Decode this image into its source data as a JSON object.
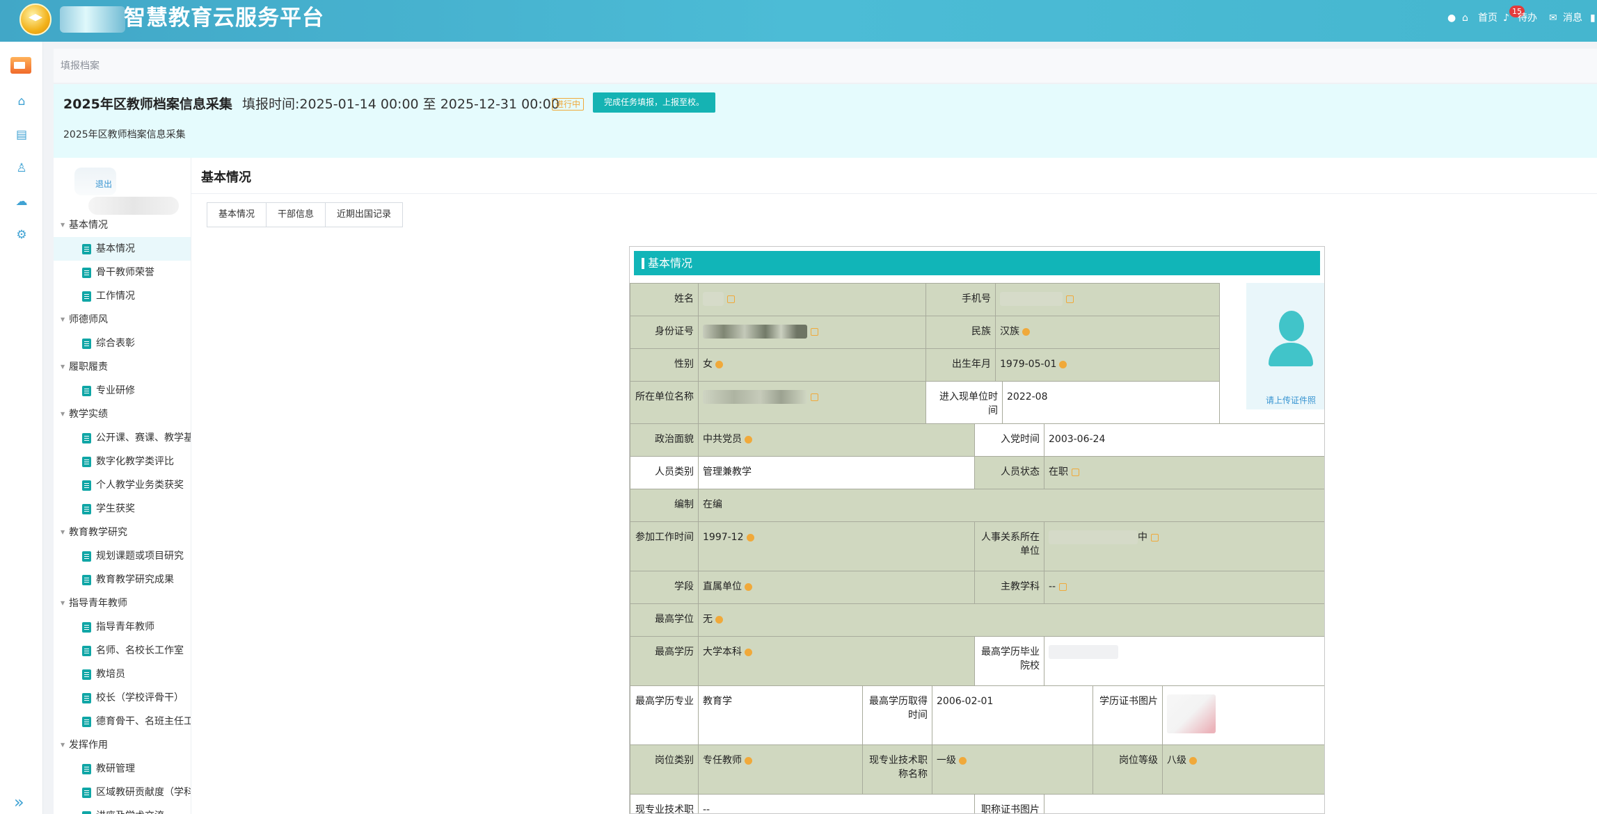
{
  "header": {
    "app_title": "智慧教育云服务平台",
    "nav": {
      "home": "首页",
      "todo": "待办",
      "todo_count": "15",
      "messages": "消息"
    }
  },
  "breadcrumb": "填报档案",
  "task": {
    "title": "2025年区教师档案信息采集",
    "time_range": "填报时间:2025-01-14 00:00 至 2025-12-31 00:00",
    "status": "进行中",
    "submit_label": "完成任务填报，上报至校。",
    "description": "2025年区教师档案信息采集"
  },
  "user_panel": {
    "logout_label": "退出"
  },
  "tree": {
    "groups": [
      {
        "label": "基本情况",
        "items": [
          "基本情况",
          "骨干教师荣誉",
          "工作情况"
        ]
      },
      {
        "label": "师德师风",
        "items": [
          "综合表彰"
        ]
      },
      {
        "label": "履职履责",
        "items": [
          "专业研修"
        ]
      },
      {
        "label": "教学实绩",
        "items": [
          "公开课、赛课、教学基",
          "数字化教学类评比",
          "个人教学业务类获奖",
          "学生获奖"
        ]
      },
      {
        "label": "教育教学研究",
        "items": [
          "规划课题或项目研究",
          "教育教学研究成果"
        ]
      },
      {
        "label": "指导青年教师",
        "items": [
          "指导青年教师",
          "名师、名校长工作室",
          "教培员",
          "校长（学校评骨干）",
          "德育骨干、名班主任工"
        ]
      },
      {
        "label": "发挥作用",
        "items": [
          "教研管理",
          "区域教研贡献度（学科",
          "讲座及学术交流"
        ]
      }
    ],
    "active": "基本情况"
  },
  "content": {
    "page_title": "基本情况",
    "tabs": [
      "基本情况",
      "干部信息",
      "近期出国记录"
    ],
    "section_title": "基本情况",
    "photo_hint": "请上传证件照",
    "labels": {
      "name": "姓名",
      "phone": "手机号",
      "id_card": "身份证号",
      "ethnicity": "民族",
      "gender": "性别",
      "birth": "出生年月",
      "unit": "所在单位名称",
      "join_unit": "进入现单位时间",
      "political": "政治面貌",
      "party_date": "入党时间",
      "staff_type": "人员类别",
      "staff_status": "人员状态",
      "establishment": "编制",
      "work_start": "参加工作时间",
      "hr_unit": "人事关系所在单位",
      "stage": "学段",
      "subject": "主教学科",
      "degree": "最高学位",
      "education": "最高学历",
      "grad_school": "最高学历毕业院校",
      "major": "最高学历专业",
      "edu_date": "最高学历取得时间",
      "cert_photo": "学历证书图片",
      "post_type": "岗位类别",
      "title_name": "现专业技术职称名称",
      "post_level": "岗位等级",
      "title_row": "现专业技术职",
      "title_photo": "职称证书图片"
    },
    "values": {
      "ethnicity": "汉族",
      "gender": "女",
      "birth": "1979-05-01",
      "join_unit": "2022-08",
      "political": "中共党员",
      "party_date": "2003-06-24",
      "staff_type": "管理兼教学",
      "staff_status": "在职",
      "establishment": "在编",
      "work_start": "1997-12",
      "hr_unit_tail": "中",
      "stage": "直属单位",
      "subject": "--",
      "degree": "无",
      "education": "大学本科",
      "major": "教育学",
      "edu_date": "2006-02-01",
      "post_type": "专任教师",
      "title_name": "一级",
      "post_level": "八级",
      "title_row": "--"
    }
  },
  "colors": {
    "header": "#45b6cf",
    "accent": "#11b5b8",
    "field_fill": "#d0d8c0",
    "warning": "#f0a93a"
  }
}
